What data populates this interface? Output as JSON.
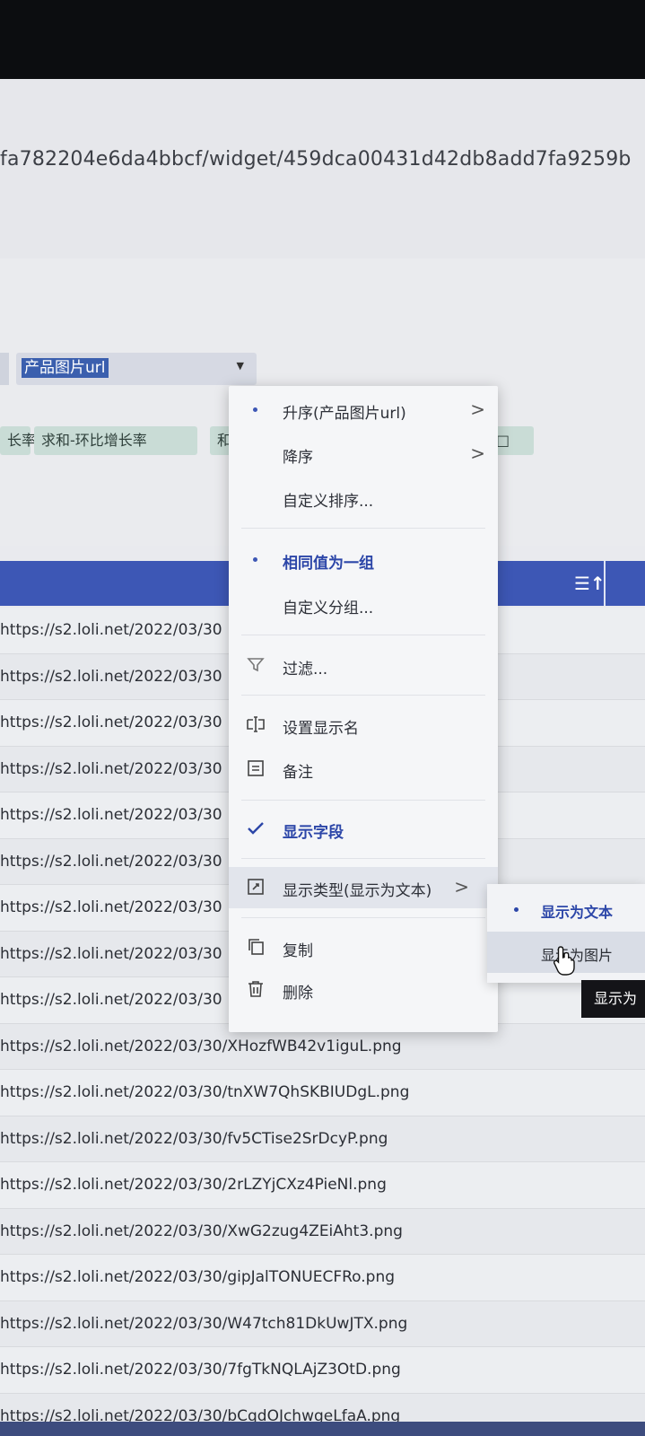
{
  "browser": {
    "url_fragment": "fa782204e6da4bbcf/widget/459dca00431d42db8add7fa9259b"
  },
  "toolbar": {
    "field_select_value": "产品图片url",
    "chips": [
      "长率",
      "求和-环比增长率",
      "和",
      "□"
    ]
  },
  "table": {
    "rows": [
      "https://s2.loli.net/2022/03/30",
      "https://s2.loli.net/2022/03/30",
      "https://s2.loli.net/2022/03/30",
      "https://s2.loli.net/2022/03/30",
      "https://s2.loli.net/2022/03/30",
      "https://s2.loli.net/2022/03/30",
      "https://s2.loli.net/2022/03/30",
      "https://s2.loli.net/2022/03/30",
      "https://s2.loli.net/2022/03/30",
      "https://s2.loli.net/2022/03/30/XHozfWB42v1iguL.png",
      "https://s2.loli.net/2022/03/30/tnXW7QhSKBIUDgL.png",
      "https://s2.loli.net/2022/03/30/fv5CTise2SrDcyP.png",
      "https://s2.loli.net/2022/03/30/2rLZYjCXz4PieNl.png",
      "https://s2.loli.net/2022/03/30/XwG2zug4ZEiAht3.png",
      "https://s2.loli.net/2022/03/30/gipJalTONUECFRo.png",
      "https://s2.loli.net/2022/03/30/W47tch81DkUwJTX.png",
      "https://s2.loli.net/2022/03/30/7fgTkNQLAjZ3OtD.png",
      "https://s2.loli.net/2022/03/30/bCqdOJchwgeLfaA.png"
    ]
  },
  "context_menu": {
    "sort_asc": "升序(产品图片url)",
    "sort_desc": "降序",
    "custom_sort": "自定义排序...",
    "group_same": "相同值为一组",
    "custom_group": "自定义分组...",
    "filter": "过滤...",
    "set_display_name": "设置显示名",
    "note": "备注",
    "show_field": "显示字段",
    "display_type": "显示类型(显示为文本)",
    "copy": "复制",
    "delete": "删除"
  },
  "submenu": {
    "as_text": "显示为文本",
    "as_image": "显示为图片"
  },
  "tooltip": "显示为",
  "colors": {
    "accent": "#3d57b5",
    "active_text": "#2c46a8"
  }
}
